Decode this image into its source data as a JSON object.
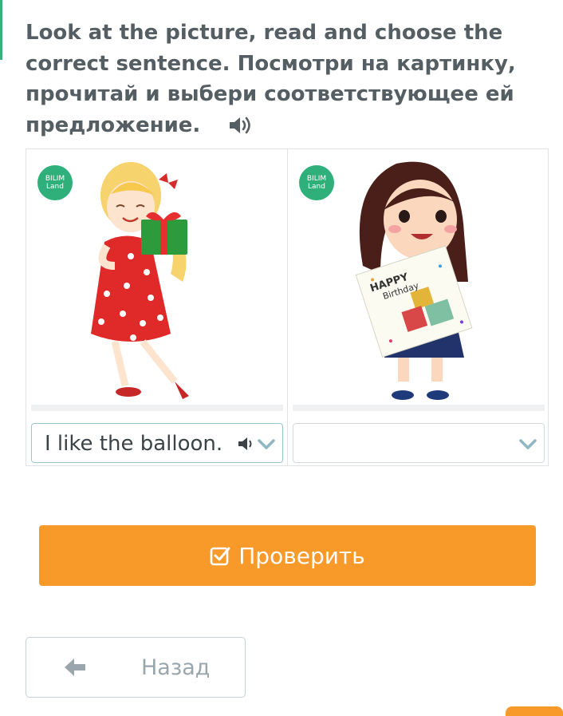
{
  "task": {
    "title": "Look at the picture, read and choose the correct sentence. Посмотри на картинку, прочитай и выбери соответствующее ей предложение.",
    "audio_icon": "speaker-icon"
  },
  "cards": [
    {
      "badge_line1": "BILIM",
      "badge_line2": "Land",
      "image": "girl-holding-gift-illustration",
      "selected_value": "I like the balloon.",
      "has_audio": true
    },
    {
      "badge_line1": "BILIM",
      "badge_line2": "Land",
      "image": "girl-holding-birthday-card-illustration",
      "card_text_line1": "HAPPY",
      "card_text_line2": "Birthday",
      "selected_value": ""
    }
  ],
  "actions": {
    "check_label": "Проверить",
    "check_icon": "checkbox-icon",
    "back_label": "Назад",
    "back_icon": "arrow-left-icon"
  },
  "colors": {
    "accent_orange": "#f89a2a",
    "brand_green": "#2fb07a",
    "text_dark": "#555f63",
    "select_border": "#9bc6cf"
  }
}
